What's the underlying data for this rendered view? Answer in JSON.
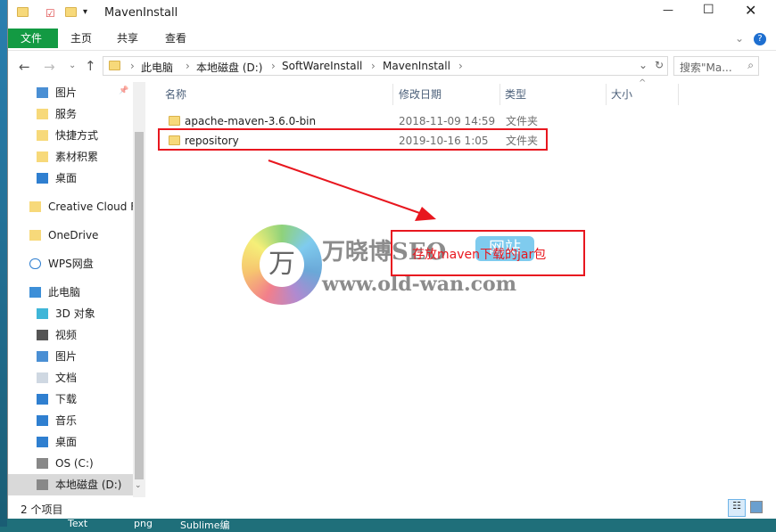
{
  "window": {
    "title": "MavenInstall"
  },
  "ribbon": {
    "tabs": [
      "文件",
      "主页",
      "共享",
      "查看"
    ]
  },
  "address": {
    "crumbs": [
      "此电脑",
      "本地磁盘 (D:)",
      "SoftWareInstall",
      "MavenInstall"
    ],
    "search_placeholder": "搜索\"Ma..."
  },
  "nav": {
    "items": [
      {
        "label": "图片",
        "icon": "pictures-icon"
      },
      {
        "label": "服务",
        "icon": "folder-icon"
      },
      {
        "label": "快捷方式",
        "icon": "folder-icon"
      },
      {
        "label": "素材积累",
        "icon": "folder-icon"
      },
      {
        "label": "桌面",
        "icon": "desktop-icon"
      },
      {
        "label": "Creative Cloud Files",
        "icon": "folder-icon"
      },
      {
        "label": "OneDrive",
        "icon": "folder-icon"
      },
      {
        "label": "WPS网盘",
        "icon": "cloud-icon"
      },
      {
        "label": "此电脑",
        "icon": "computer-icon"
      },
      {
        "label": "3D 对象",
        "icon": "3d-icon"
      },
      {
        "label": "视频",
        "icon": "video-icon"
      },
      {
        "label": "图片",
        "icon": "pictures-icon"
      },
      {
        "label": "文档",
        "icon": "documents-icon"
      },
      {
        "label": "下载",
        "icon": "download-icon"
      },
      {
        "label": "音乐",
        "icon": "music-icon"
      },
      {
        "label": "桌面",
        "icon": "desktop-icon"
      },
      {
        "label": "OS (C:)",
        "icon": "drive-icon"
      },
      {
        "label": "本地磁盘 (D:)",
        "icon": "drive-icon"
      }
    ]
  },
  "columns": [
    "名称",
    "修改日期",
    "类型",
    "大小"
  ],
  "files": [
    {
      "name": "apache-maven-3.6.0-bin",
      "date": "2018-11-09 14:59",
      "type": "文件夹"
    },
    {
      "name": "repository",
      "date": "2019-10-16 1:05",
      "type": "文件夹"
    }
  ],
  "annotation": "存放maven下载的jar包",
  "watermark": {
    "title": "万晓博SEO",
    "badge": "网站",
    "url": "www.old-wan.com"
  },
  "status": {
    "count": "2 个项目"
  },
  "taskbar": [
    "Text",
    "png",
    "Sublime编"
  ],
  "colors": {
    "file_tab": "#139a43",
    "annotation": "#e8171f"
  }
}
